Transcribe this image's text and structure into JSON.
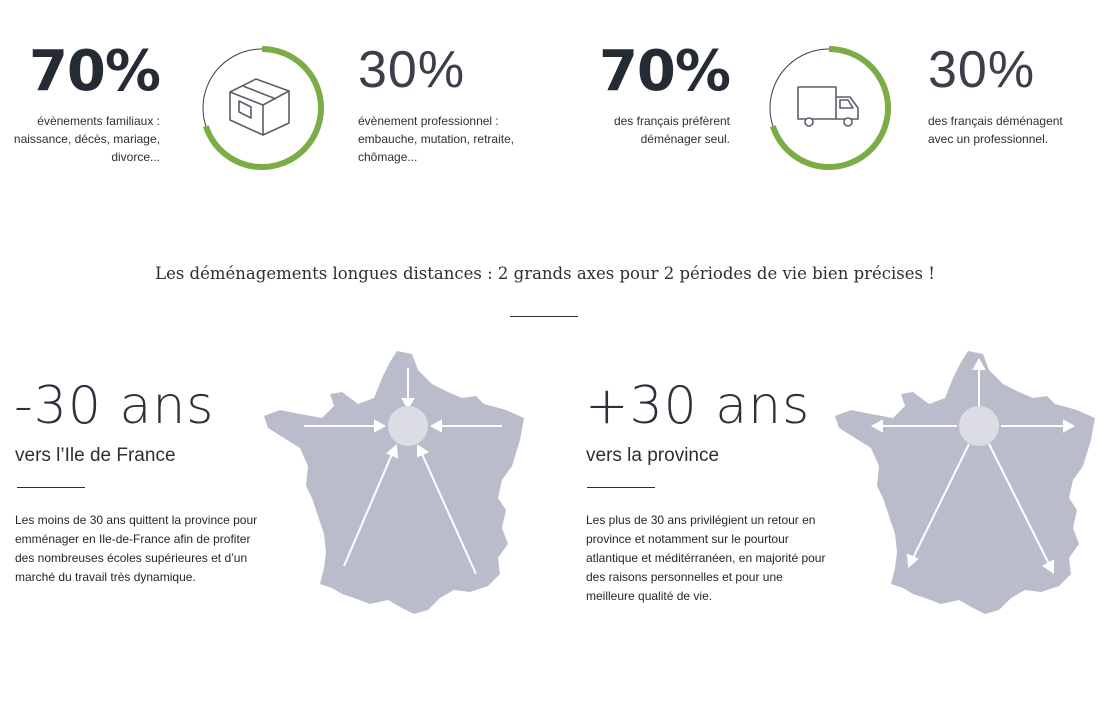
{
  "stats": [
    {
      "value": "70%",
      "label": "évènements familiaux : naissance, décès, mariage, divorce..."
    },
    {
      "value": "30%",
      "label": "évènement professionnel : embauche, mutation, retraite, chômage..."
    },
    {
      "value": "70%",
      "label": "des français préfèrent déménager seul."
    },
    {
      "value": "30%",
      "label": "des français déménagent avec un professionnel."
    }
  ],
  "rings": [
    {
      "icon": "box-icon",
      "fraction": 0.7
    },
    {
      "icon": "truck-icon",
      "fraction": 0.7
    }
  ],
  "heading": "Les déménagements longues distances :  2 grands axes pour 2 périodes de vie bien précises !",
  "panels": [
    {
      "age": "-30 ans",
      "destination": "vers l’Ile de France",
      "text": "Les moins de 30 ans quittent la province pour emménager en Ile-de-France afin de profiter des nombreuses écoles supérieures et d’un marché du travail très dynamique.",
      "map": "france-map-inbound-icon"
    },
    {
      "age": "+30 ans",
      "destination": "vers la province",
      "text": "Les plus de 30 ans privilégient un retour en province et notamment sur le pourtour atlantique et méditérranéen, en majorité pour des raisons personnelles et pour une meilleure qualité de vie.",
      "map": "france-map-outbound-icon"
    }
  ],
  "colors": {
    "accent": "#7bac45",
    "map": "#b9bdcb",
    "hub": "#dcdde4",
    "ring_track": "#3a3f48"
  }
}
